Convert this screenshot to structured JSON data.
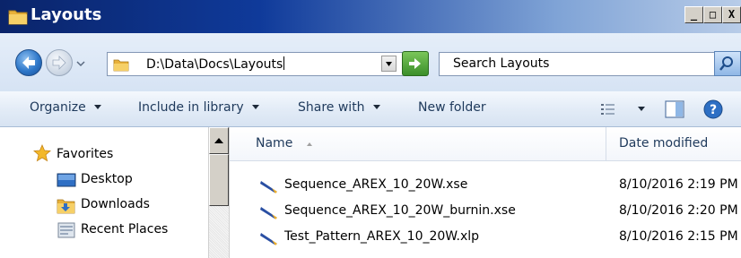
{
  "window": {
    "title": "Layouts",
    "buttons": {
      "minimize": "_",
      "maximize": "□",
      "close": "X"
    }
  },
  "address": {
    "path": "D:\\Data\\Docs\\Layouts"
  },
  "search": {
    "placeholder": "Search Layouts"
  },
  "toolbar": {
    "organize": "Organize",
    "include_in_library": "Include in library",
    "share_with": "Share with",
    "new_folder": "New folder",
    "icons": [
      "view-options-icon",
      "preview-pane-icon",
      "help-icon"
    ]
  },
  "nav": {
    "favorites": "Favorites",
    "items": [
      {
        "label": "Desktop",
        "icon": "desktop-icon"
      },
      {
        "label": "Downloads",
        "icon": "downloads-icon"
      },
      {
        "label": "Recent Places",
        "icon": "recent-places-icon"
      }
    ]
  },
  "columns": {
    "name": "Name",
    "date_modified": "Date modified"
  },
  "files": [
    {
      "name": "Sequence_AREX_10_20W.xse",
      "date": "8/10/2016 2:19 PM"
    },
    {
      "name": "Sequence_AREX_10_20W_burnin.xse",
      "date": "8/10/2016 2:20 PM"
    },
    {
      "name": "Test_Pattern_AREX_10_20W.xlp",
      "date": "8/10/2016 2:15 PM"
    }
  ]
}
